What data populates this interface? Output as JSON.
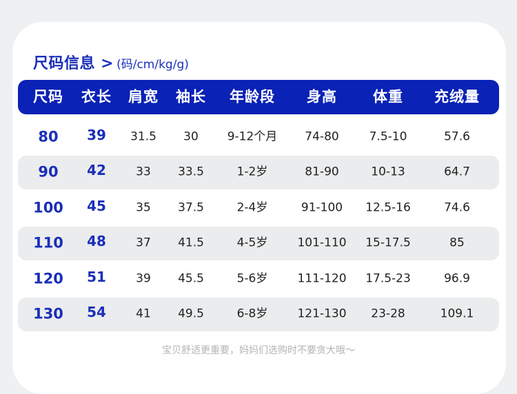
{
  "heading": {
    "title": "尺码信息 >",
    "unit": "(码/cm/kg/g)"
  },
  "table": {
    "columns": [
      "尺码",
      "衣长",
      "肩宽",
      "袖长",
      "年龄段",
      "身高",
      "体重",
      "充绒量"
    ],
    "rows": [
      [
        "80",
        "39",
        "31.5",
        "30",
        "9-12个月",
        "74-80",
        "7.5-10",
        "57.6"
      ],
      [
        "90",
        "42",
        "33",
        "33.5",
        "1-2岁",
        "81-90",
        "10-13",
        "64.7"
      ],
      [
        "100",
        "45",
        "35",
        "37.5",
        "2-4岁",
        "91-100",
        "12.5-16",
        "74.6"
      ],
      [
        "110",
        "48",
        "37",
        "41.5",
        "4-5岁",
        "101-110",
        "15-17.5",
        "85"
      ],
      [
        "120",
        "51",
        "39",
        "45.5",
        "5-6岁",
        "111-120",
        "17.5-23",
        "96.9"
      ],
      [
        "130",
        "54",
        "41",
        "49.5",
        "6-8岁",
        "121-130",
        "23-28",
        "109.1"
      ]
    ]
  },
  "footer": {
    "note": "宝贝舒适更重要，妈妈们选购时不要贪大哦～"
  }
}
